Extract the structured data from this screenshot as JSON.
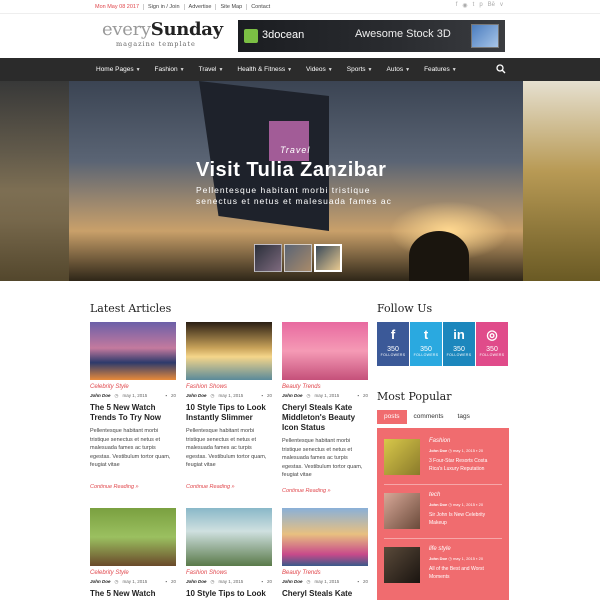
{
  "topbar": {
    "date": "Mon May 08 2017",
    "links": [
      "Sign in / Join",
      "Advertise",
      "Site Map",
      "Contact"
    ],
    "social": [
      "facebook-icon",
      "rss-icon",
      "twitter-icon",
      "pinterest-icon",
      "behance-icon",
      "vimeo-icon"
    ]
  },
  "logo": {
    "light": "every",
    "bold": "Sunday",
    "tagline": "magazine template"
  },
  "banner": {
    "brand": "3docean",
    "text": "Awesome Stock 3D"
  },
  "nav": {
    "items": [
      {
        "label": "Home Pages",
        "dropdown": true
      },
      {
        "label": "Fashion",
        "dropdown": true
      },
      {
        "label": "Travel",
        "dropdown": true
      },
      {
        "label": "Health & Fitness",
        "dropdown": true
      },
      {
        "label": "Videos",
        "dropdown": true
      },
      {
        "label": "Sports",
        "dropdown": true
      },
      {
        "label": "Autos",
        "dropdown": true
      },
      {
        "label": "Features",
        "dropdown": true
      }
    ]
  },
  "hero": {
    "category": "Travel",
    "title": "Visit Tulia Zanzibar",
    "subtitle_line1": "Pellentesque habitant morbi tristique",
    "subtitle_line2": "senectus et netus et malesuada fames ac"
  },
  "latest": {
    "title": "Latest Articles",
    "cards": [
      {
        "category": "Celebrity Style",
        "author": "John Doe",
        "date": "may 1, 2015",
        "comments": "20",
        "title": "The 5 New Watch Trends To Try Now",
        "excerpt": "Pellentesque habitant morbi tristique senectus et netus et malesuada fames ac turpis egestas. Vestibulum tortor quam, feugiat vitae",
        "more": "Continue Reading »"
      },
      {
        "category": "Fashion Shows",
        "author": "John Doe",
        "date": "may 1, 2015",
        "comments": "20",
        "title": "10 Style Tips to Look Instantly Slimmer",
        "excerpt": "Pellentesque habitant morbi tristique senectus et netus et malesuada fames ac turpis egestas. Vestibulum tortor quam, feugiat vitae",
        "more": "Continue Reading »"
      },
      {
        "category": "Beauty Trends",
        "author": "John Doe",
        "date": "may 1, 2015",
        "comments": "20",
        "title": "Cheryl Steals Kate Middleton's Beauty Icon Status",
        "excerpt": "Pellentesque habitant morbi tristique senectus et netus et malesuada fames ac turpis egestas. Vestibulum tortor quam, feugiat vitae",
        "more": "Continue Reading »"
      },
      {
        "category": "Celebrity Style",
        "author": "John Doe",
        "date": "may 1, 2015",
        "comments": "20",
        "title": "The 5 New Watch"
      },
      {
        "category": "Fashion Shows",
        "author": "John Doe",
        "date": "may 1, 2015",
        "comments": "20",
        "title": "10 Style Tips to Look"
      },
      {
        "category": "Beauty Trends",
        "author": "John Doe",
        "date": "may 1, 2015",
        "comments": "20",
        "title": "Cheryl Steals Kate"
      }
    ]
  },
  "follow": {
    "title": "Follow Us",
    "items": [
      {
        "icon": "f",
        "count": "350",
        "label": "FOLLOWERS",
        "color": "#3b5998"
      },
      {
        "icon": "t",
        "count": "350",
        "label": "FOLLOWERS",
        "color": "#2aa9e0"
      },
      {
        "icon": "in",
        "count": "350",
        "label": "FOLLOWERS",
        "color": "#1c87bd"
      },
      {
        "icon": "d",
        "count": "350",
        "label": "FOLLOWERS",
        "color": "#e04b8a"
      }
    ]
  },
  "popular": {
    "title": "Most Popular",
    "tabs": [
      "posts",
      "comments",
      "tags"
    ],
    "items": [
      {
        "category": "Fashion",
        "author": "John Doe",
        "date": "may 1, 2015",
        "comments": "20",
        "title": "3 Four-Star Resorts Costa Rica's Luxury Reputation"
      },
      {
        "category": "tech",
        "author": "John Doe",
        "date": "may 1, 2015",
        "comments": "20",
        "title": "Sir John Is New Celebrity Makeup"
      },
      {
        "category": "life style",
        "author": "John Doe",
        "date": "may 1, 2015",
        "comments": "20",
        "title": "All of the Best and Worst Moments"
      }
    ]
  },
  "colors": {
    "accent": "#e0474c",
    "pop_bg": "#f06c6f",
    "nav_bg": "#2b2b2b"
  }
}
